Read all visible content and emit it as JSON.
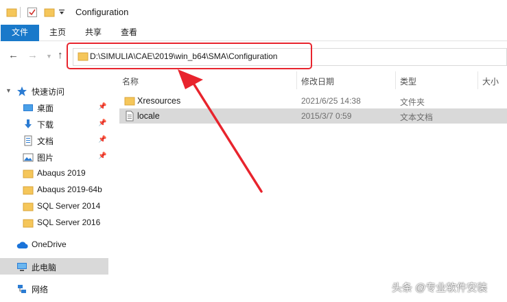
{
  "window": {
    "title": "Configuration"
  },
  "ribbon": {
    "tabs": [
      "文件",
      "主页",
      "共享",
      "查看"
    ]
  },
  "address": {
    "path": "D:\\SIMULIA\\CAE\\2019\\win_b64\\SMA\\Configuration"
  },
  "sidebar": {
    "quick_access": "快速访问",
    "pinned": [
      {
        "label": "桌面",
        "icon": "desktop-icon"
      },
      {
        "label": "下载",
        "icon": "download-icon"
      },
      {
        "label": "文档",
        "icon": "document-icon"
      },
      {
        "label": "图片",
        "icon": "picture-icon"
      }
    ],
    "folders": [
      "Abaqus 2019",
      "Abaqus 2019-64b",
      "SQL Server 2014",
      "SQL Server 2016"
    ],
    "onedrive": "OneDrive",
    "this_pc": "此电脑",
    "network": "网络"
  },
  "columns": {
    "name": "名称",
    "date": "修改日期",
    "type": "类型",
    "size": "大小"
  },
  "files": [
    {
      "name": "Xresources",
      "date": "2021/6/25 14:38",
      "type": "文件夹",
      "icon": "folder-icon"
    },
    {
      "name": "locale",
      "date": "2015/3/7 0:59",
      "type": "文本文档",
      "icon": "text-file-icon"
    }
  ],
  "watermark": "头条 @专业软件安装",
  "colors": {
    "accent": "#1979ca",
    "highlight": "#e8242d",
    "selection": "#d9d9d9",
    "folder": "#f5c65a"
  }
}
